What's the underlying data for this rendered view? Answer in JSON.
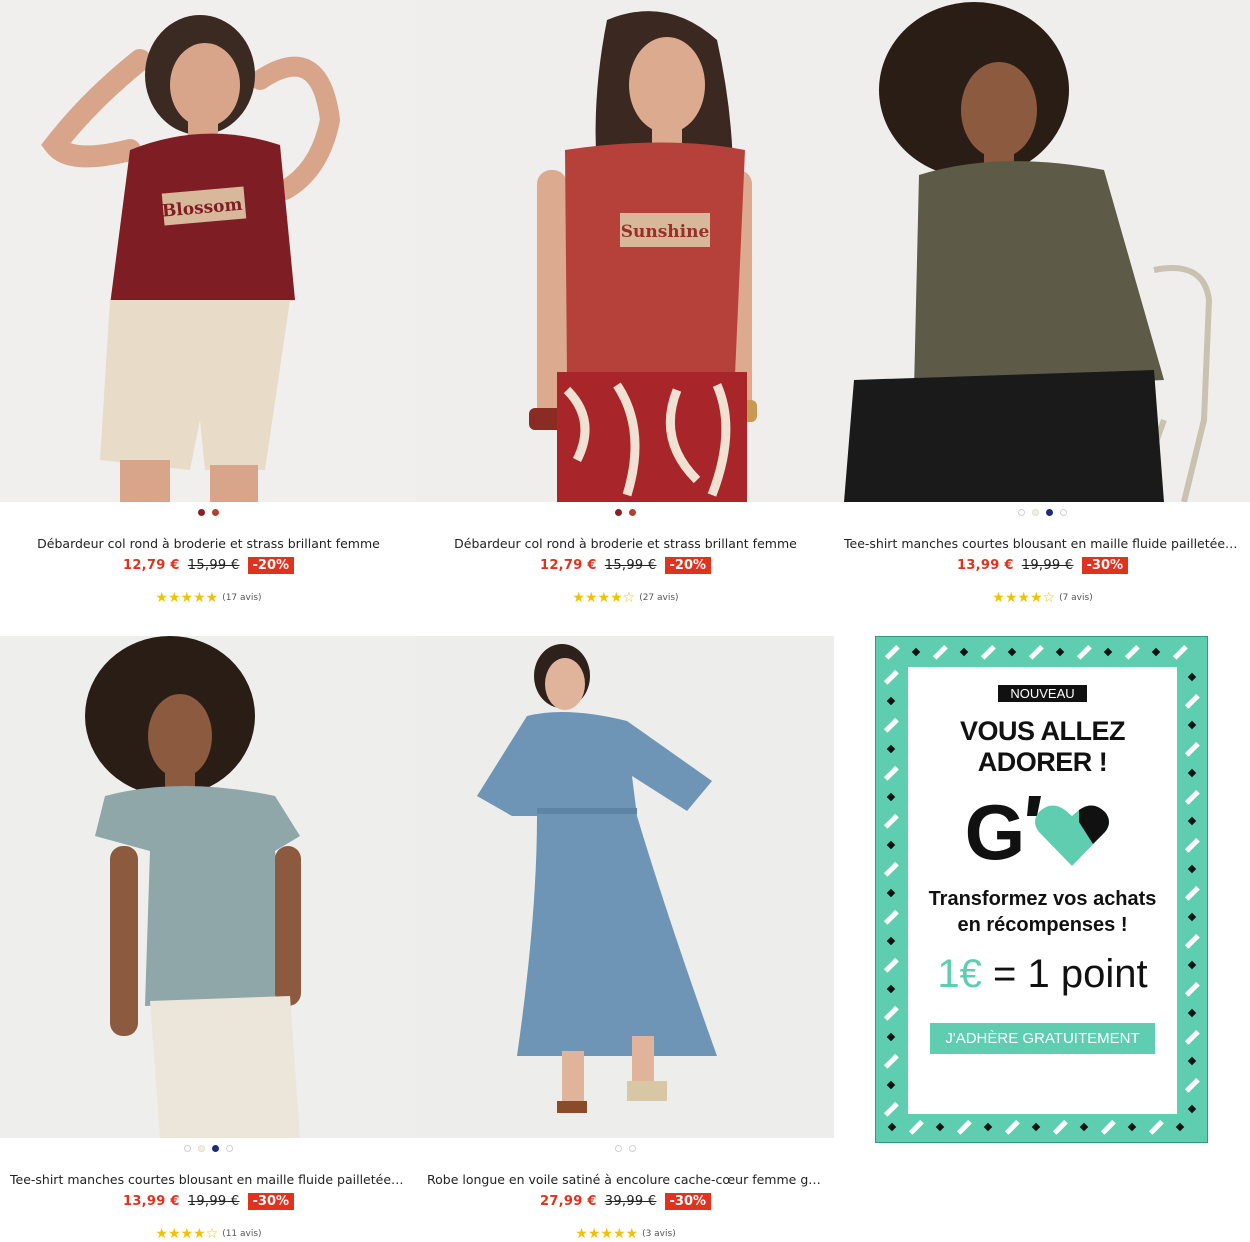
{
  "products": [
    {
      "title": "Débardeur col rond à broderie et strass brillant femme",
      "price": "12,79 €",
      "old_price": "15,99 €",
      "discount": "-20%",
      "stars": "★★★★★",
      "reviews": "(17 avis)",
      "swatches": [
        "#8a1f22",
        "#b3402f"
      ],
      "print_text": "Blossom",
      "colors": {
        "top": "#7f1d24",
        "bottom": "#e8dcc8"
      }
    },
    {
      "title": "Débardeur col rond à broderie et strass brillant femme",
      "price": "12,79 €",
      "old_price": "15,99 €",
      "discount": "-20%",
      "stars": "★★★★☆",
      "reviews": "(27 avis)",
      "swatches": [
        "#8a1f22",
        "#b3402f"
      ],
      "print_text": "Sunshine",
      "colors": {
        "top": "#b5413a",
        "bottom": "#a8252a"
      }
    },
    {
      "title": "Tee-shirt manches courtes blousant en maille fluide pailletée femme",
      "price": "13,99 €",
      "old_price": "19,99 €",
      "discount": "-30%",
      "stars": "★★★★☆",
      "reviews": "(7 avis)",
      "swatches": [
        "outline",
        "#f4f0d8",
        "#1d2a7a",
        "outline"
      ],
      "colors": {
        "top": "#5d5b47",
        "bottom": "#1a1a1a"
      }
    },
    {
      "title": "Tee-shirt manches courtes blousant en maille fluide pailletée femme",
      "price": "13,99 €",
      "old_price": "19,99 €",
      "discount": "-30%",
      "stars": "★★★★☆",
      "reviews": "(11 avis)",
      "swatches": [
        "outline",
        "#f4f0d8",
        "#1d2a7a",
        "outline"
      ],
      "colors": {
        "top": "#8fa7a8",
        "bottom": "#ece6da"
      }
    },
    {
      "title": "Robe longue en voile satiné à encolure cache-cœur femme grande …",
      "price": "27,99 €",
      "old_price": "39,99 €",
      "discount": "-30%",
      "stars": "★★★★★",
      "reviews": "(3 avis)",
      "swatches": [
        "outline",
        "outline"
      ],
      "colors": {
        "top": "#6f95b6",
        "bottom": "#6f95b6"
      }
    }
  ],
  "promo": {
    "badge": "NOUVEAU",
    "headline_1": "VOUS ALLEZ",
    "headline_2": "ADORER !",
    "logo_letter": "G",
    "sub_1": "Transformez vos achats",
    "sub_2": "en récompenses !",
    "points_left": "1€",
    "points_right": "= 1 point",
    "cta": "J'ADHÈRE GRATUITEMENT",
    "accent": "#5fceb0"
  }
}
